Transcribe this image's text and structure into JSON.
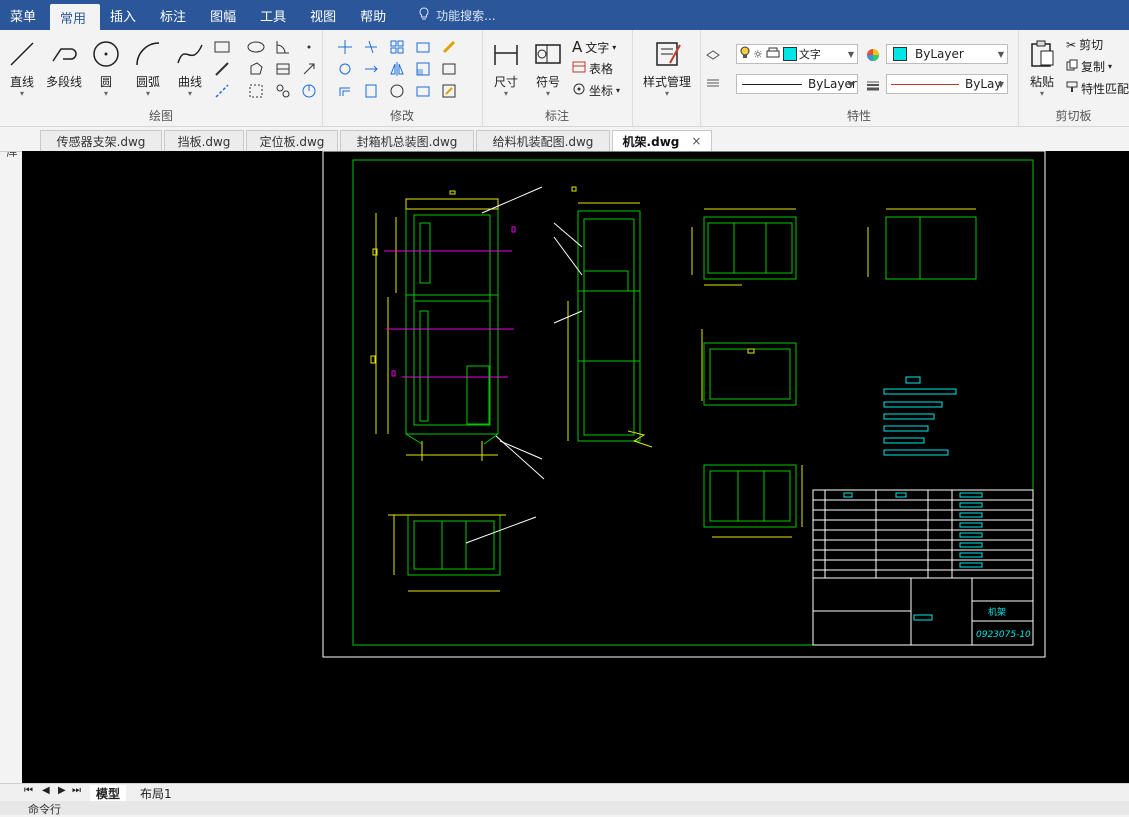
{
  "menubar": {
    "items": [
      "菜单",
      "常用",
      "插入",
      "标注",
      "图幅",
      "工具",
      "视图",
      "帮助"
    ],
    "search_placeholder": "功能搜索..."
  },
  "ribbon": {
    "draw": {
      "title": "绘图",
      "line": "直线",
      "polyline": "多段线",
      "circle": "圆",
      "arc": "圆弧",
      "curve": "曲线"
    },
    "modify": {
      "title": "修改"
    },
    "annotate": {
      "title": "标注",
      "dimension": "尺寸",
      "symbol": "符号",
      "text": "文字",
      "table": "表格",
      "coord": "坐标"
    },
    "style": {
      "label": "样式管理"
    },
    "props": {
      "title": "特性",
      "text_style": "文字",
      "layer": "ByLayer",
      "linetype": "ByLayer",
      "lineweight": "ByLay"
    },
    "clipboard": {
      "title": "剪切板",
      "paste": "粘贴",
      "cut": "剪切",
      "copy": "复制",
      "match": "特性匹配"
    }
  },
  "tabs": [
    "传感器支架.dwg",
    "挡板.dwg",
    "定位板.dwg",
    "封箱机总装图.dwg",
    "给料机装配图.dwg",
    "机架.dwg"
  ],
  "left_panel": {
    "label": "图库"
  },
  "drawing": {
    "title_text": "机架",
    "drawing_number": "0923075-10"
  },
  "layout_tabs": [
    "模型",
    "布局1"
  ],
  "command_prompt": "命令行",
  "colors": {
    "menubar": "#2b579a",
    "canvas": "#000000",
    "frame": "#00c800",
    "yellow": "#e6e600",
    "cyan": "#00e6e6",
    "magenta": "#e600e6"
  }
}
